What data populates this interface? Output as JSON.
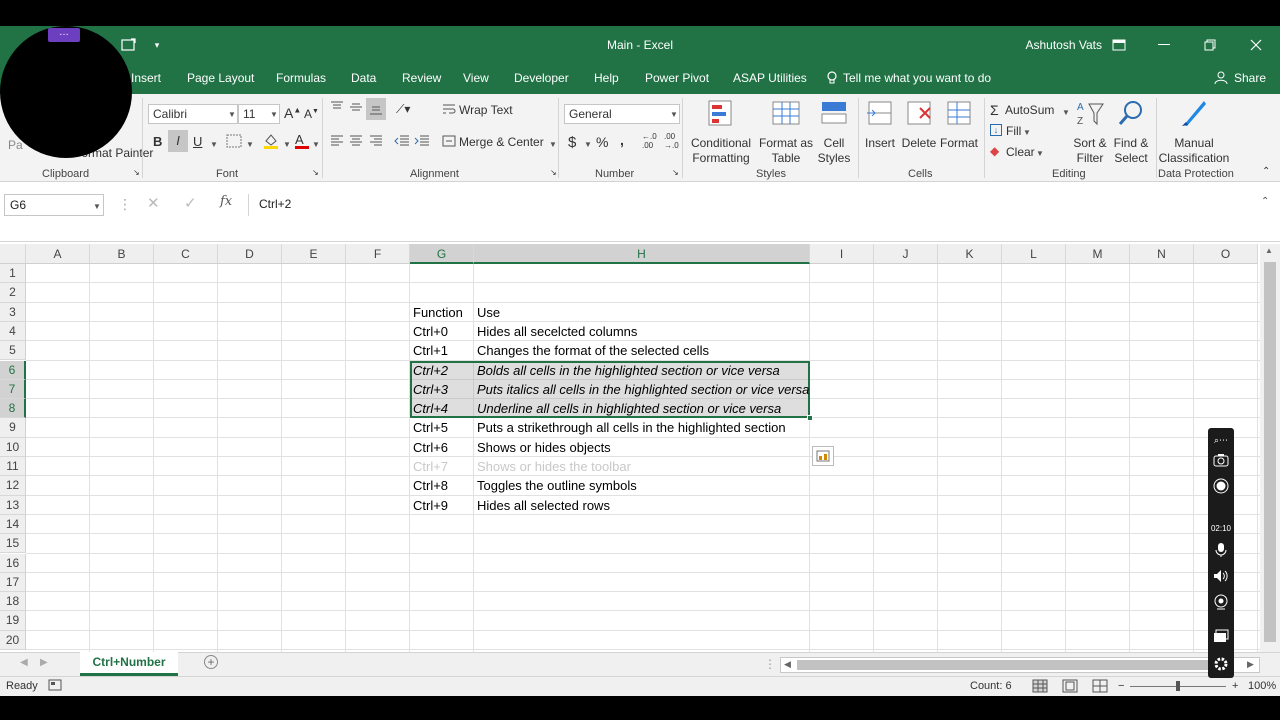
{
  "titlebar": {
    "title": "Main  -  Excel",
    "user": "Ashutosh Vats",
    "controls": [
      "ribbon-display-icon",
      "minimize-icon",
      "restore-icon",
      "close-icon"
    ]
  },
  "menu": {
    "tabs": [
      "Insert",
      "Page Layout",
      "Formulas",
      "Data",
      "Review",
      "View",
      "Developer",
      "Help",
      "Power Pivot",
      "ASAP Utilities"
    ],
    "tell_me": "Tell me what you want to do",
    "share": "Share"
  },
  "ribbon": {
    "clipboard": {
      "label": "Clipboard",
      "format_painter": "Format Painter",
      "paste_partial": "Pa"
    },
    "font": {
      "label": "Font",
      "name": "Calibri",
      "size": "11"
    },
    "alignment": {
      "label": "Alignment",
      "wrap_text": "Wrap Text",
      "merge_center": "Merge & Center"
    },
    "number": {
      "label": "Number",
      "format": "General"
    },
    "styles": {
      "label": "Styles",
      "conditional": "Conditional\nFormatting",
      "format_table": "Format as\nTable",
      "cell_styles": "Cell\nStyles"
    },
    "cells": {
      "label": "Cells",
      "insert": "Insert",
      "delete": "Delete",
      "format": "Format"
    },
    "editing": {
      "label": "Editing",
      "autosum": "AutoSum",
      "fill": "Fill",
      "clear": "Clear",
      "sort_filter": "Sort &\nFilter",
      "find_select": "Find &\nSelect"
    },
    "data_protection": {
      "label": "Data Protection",
      "manual": "Manual\nClassification"
    }
  },
  "formula_bar": {
    "name_box": "G6",
    "formula": "Ctrl+2",
    "fx": "fx"
  },
  "grid": {
    "columns": [
      "A",
      "B",
      "C",
      "D",
      "E",
      "F",
      "G",
      "H",
      "I",
      "J",
      "K",
      "L",
      "M",
      "N",
      "O"
    ],
    "rows": [
      "1",
      "2",
      "3",
      "4",
      "5",
      "6",
      "7",
      "8",
      "9",
      "10",
      "11",
      "12",
      "13",
      "14",
      "15",
      "16",
      "17",
      "18",
      "19",
      "20"
    ],
    "table": [
      {
        "row": 3,
        "g": "Function",
        "h": "Use",
        "style": "normal"
      },
      {
        "row": 4,
        "g": "Ctrl+0",
        "h": "Hides all secelcted columns",
        "style": "normal"
      },
      {
        "row": 5,
        "g": "Ctrl+1",
        "h": "Changes the format of the selected cells",
        "style": "normal"
      },
      {
        "row": 6,
        "g": "Ctrl+2",
        "h": "Bolds all cells in the highlighted section or vice versa",
        "style": "ital"
      },
      {
        "row": 7,
        "g": "Ctrl+3",
        "h": "Puts italics all cells in the highlighted section or vice versa",
        "style": "ital"
      },
      {
        "row": 8,
        "g": "Ctrl+4",
        "h": "Underline all cells in highlighted section or vice versa",
        "style": "ital"
      },
      {
        "row": 9,
        "g": "Ctrl+5",
        "h": "Puts a strikethrough all cells in the highlighted section",
        "style": "normal"
      },
      {
        "row": 10,
        "g": "Ctrl+6",
        "h": "Shows or hides objects",
        "style": "normal"
      },
      {
        "row": 11,
        "g": "Ctrl+7",
        "h": "Shows or hides the toolbar",
        "style": "faded"
      },
      {
        "row": 12,
        "g": "Ctrl+8",
        "h": "Toggles the outline symbols",
        "style": "normal"
      },
      {
        "row": 13,
        "g": "Ctrl+9",
        "h": "Hides all selected rows",
        "style": "normal"
      }
    ]
  },
  "sheets": {
    "active": "Ctrl+Number"
  },
  "status": {
    "ready": "Ready",
    "count": "Count: 6",
    "zoom": "100%"
  },
  "recorder": {
    "time": "02:10"
  },
  "colors": {
    "excel_green": "#217346",
    "selection": "#a0a0a0"
  }
}
